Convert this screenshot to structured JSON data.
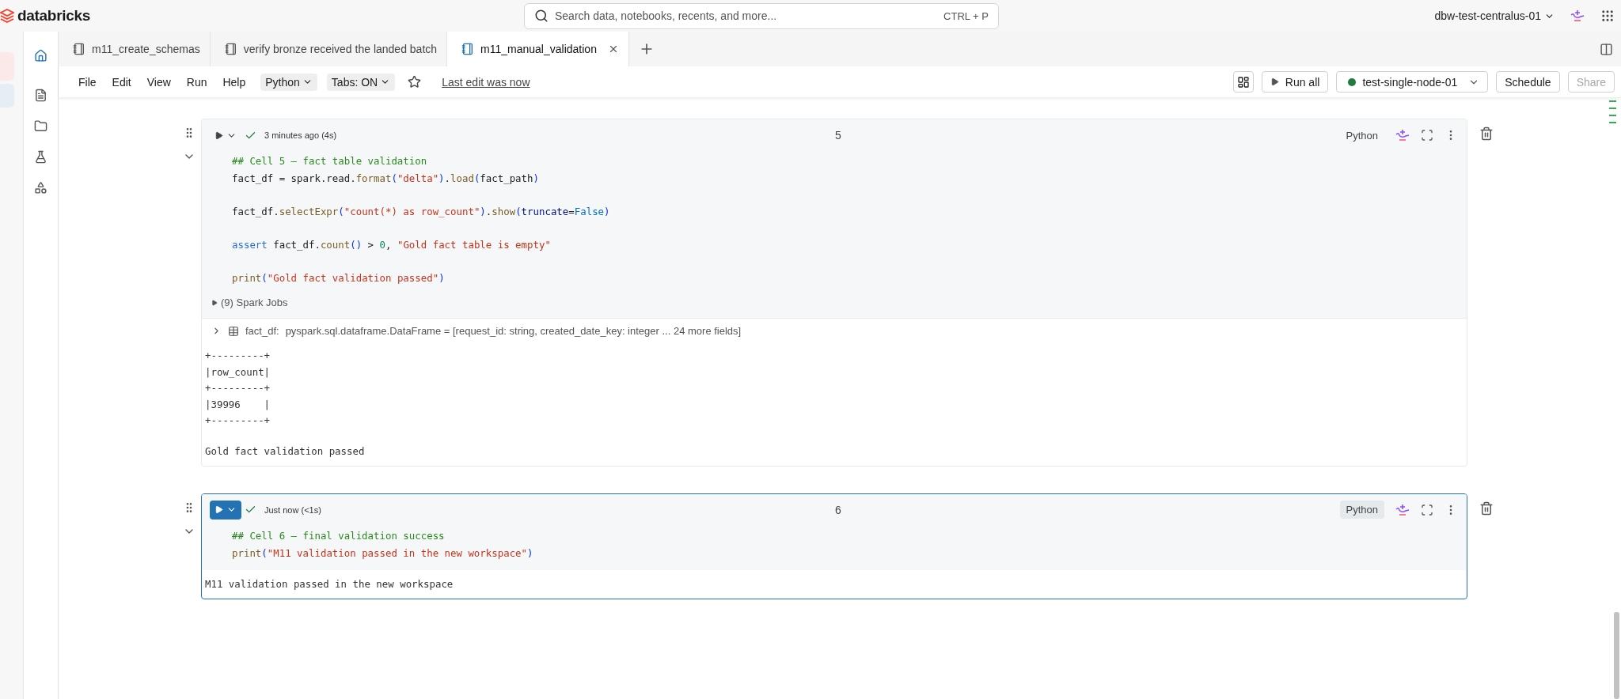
{
  "header": {
    "logo_text": "databricks",
    "search": {
      "placeholder": "Search data, notebooks, recents, and more...",
      "shortcut": "CTRL + P"
    },
    "workspace": "dbw-test-centralus-01"
  },
  "tabs": [
    {
      "label": "m11_create_schemas",
      "selected": false
    },
    {
      "label": "verify bronze received the landed batch",
      "selected": false
    },
    {
      "label": "m11_manual_validation",
      "selected": true
    }
  ],
  "menu": [
    "File",
    "Edit",
    "View",
    "Run",
    "Help"
  ],
  "language_menu": "Python",
  "tabs_setting": "Tabs: ON",
  "last_edit": "Last edit was now",
  "toolbar": {
    "run_all": "Run all",
    "cluster": {
      "name": "test-single-node-01"
    },
    "schedule": "Schedule",
    "share": {
      "label": "Share",
      "disabled": true
    }
  },
  "cells": [
    {
      "selected": false,
      "status": "3 minutes ago (4s)",
      "number": "5",
      "language": "Python",
      "code": [
        {
          "kind": "code",
          "tokens": [
            {
              "kind": "comment",
              "text": "## Cell 5 — fact table validation"
            }
          ]
        },
        {
          "kind": "code",
          "tokens": [
            {
              "kind": "text",
              "text": "fact_df = spark.read."
            },
            {
              "kind": "func",
              "text": "format"
            },
            {
              "kind": "bracket",
              "text": "("
            },
            {
              "kind": "string",
              "text": "\"delta\""
            },
            {
              "kind": "bracket",
              "text": ")"
            },
            {
              "kind": "text",
              "text": "."
            },
            {
              "kind": "func",
              "text": "load"
            },
            {
              "kind": "bracket",
              "text": "("
            },
            {
              "kind": "text",
              "text": "fact_path"
            },
            {
              "kind": "bracket",
              "text": ")"
            }
          ]
        },
        {
          "kind": "blank"
        },
        {
          "kind": "code",
          "tokens": [
            {
              "kind": "text",
              "text": "fact_df."
            },
            {
              "kind": "func",
              "text": "selectExpr"
            },
            {
              "kind": "bracket",
              "text": "("
            },
            {
              "kind": "string",
              "text": "\"count(*) as row_count\""
            },
            {
              "kind": "bracket",
              "text": ")"
            },
            {
              "kind": "text",
              "text": "."
            },
            {
              "kind": "func",
              "text": "show"
            },
            {
              "kind": "bracket",
              "text": "("
            },
            {
              "kind": "param",
              "text": "truncate"
            },
            {
              "kind": "text",
              "text": "="
            },
            {
              "kind": "bool",
              "text": "False"
            },
            {
              "kind": "bracket",
              "text": ")"
            }
          ]
        },
        {
          "kind": "blank"
        },
        {
          "kind": "code",
          "tokens": [
            {
              "kind": "keyword",
              "text": "assert"
            },
            {
              "kind": "text",
              "text": " fact_df."
            },
            {
              "kind": "func",
              "text": "count"
            },
            {
              "kind": "bracket",
              "text": "()"
            },
            {
              "kind": "text",
              "text": " > "
            },
            {
              "kind": "number",
              "text": "0"
            },
            {
              "kind": "text",
              "text": ", "
            },
            {
              "kind": "string",
              "text": "\"Gold fact table is empty\""
            }
          ]
        },
        {
          "kind": "blank"
        },
        {
          "kind": "code",
          "tokens": [
            {
              "kind": "func",
              "text": "print"
            },
            {
              "kind": "bracket",
              "text": "("
            },
            {
              "kind": "string",
              "text": "\"Gold fact validation passed\""
            },
            {
              "kind": "bracket",
              "text": ")"
            }
          ]
        }
      ],
      "spark_jobs": "(9) Spark Jobs",
      "dataframe": {
        "name": "fact_df:",
        "schema": "pyspark.sql.dataframe.DataFrame = [request_id: string, created_date_key: integer ... 24 more fields]"
      },
      "output": {
        "table": [
          "+---------+",
          "|row_count|",
          "+---------+",
          "|39996    |",
          "+---------+"
        ],
        "message": "Gold fact validation passed"
      }
    },
    {
      "selected": true,
      "status": "Just now (<1s)",
      "number": "6",
      "language": "Python",
      "code": [
        {
          "kind": "code",
          "tokens": [
            {
              "kind": "comment",
              "text": "## Cell 6 — final validation success"
            }
          ]
        },
        {
          "kind": "code",
          "tokens": [
            {
              "kind": "func",
              "text": "print"
            },
            {
              "kind": "bracket",
              "text": "("
            },
            {
              "kind": "string",
              "text": "\"M11 validation passed in the new workspace\""
            },
            {
              "kind": "bracket",
              "text": ")"
            }
          ]
        }
      ],
      "output": {
        "message": "M11 validation passed in the new workspace"
      }
    }
  ]
}
